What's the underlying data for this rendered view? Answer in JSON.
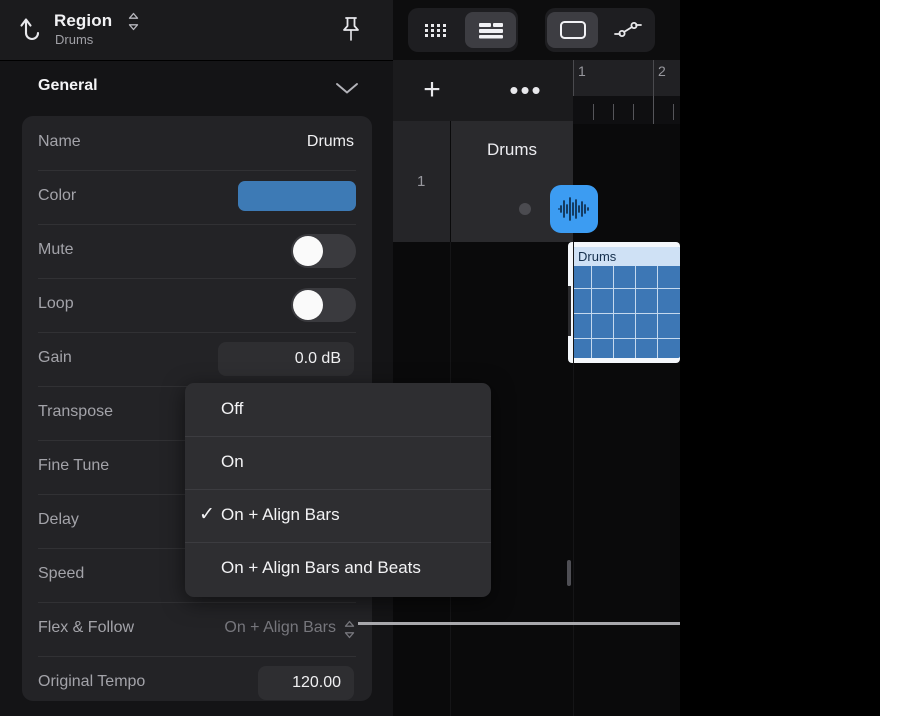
{
  "app": {
    "accent_blue": "#3c77b5",
    "track_icon_blue": "#3c9cf2",
    "color_swatch": "#3d7ab5"
  },
  "inspector": {
    "header": {
      "title": "Region",
      "subtitle": "Drums",
      "back_icon": "back-arrow-icon",
      "stepper_icon": "stepper-chevrons-icon",
      "pin_icon": "pin-icon"
    },
    "section": {
      "title": "General",
      "chevron_icon": "chevron-down-icon"
    },
    "parameters": [
      {
        "label": "Name",
        "value": "Drums",
        "kind": "text"
      },
      {
        "label": "Color",
        "value": "",
        "kind": "swatch"
      },
      {
        "label": "Mute",
        "value": "off",
        "kind": "toggle"
      },
      {
        "label": "Loop",
        "value": "off",
        "kind": "toggle"
      },
      {
        "label": "Gain",
        "value": "0.0 dB",
        "kind": "field"
      },
      {
        "label": "Transpose",
        "value": "",
        "kind": "hidden"
      },
      {
        "label": "Fine Tune",
        "value": "",
        "kind": "hidden"
      },
      {
        "label": "Delay",
        "value": "",
        "kind": "hidden"
      },
      {
        "label": "Speed",
        "value": "",
        "kind": "hidden"
      },
      {
        "label": "Flex & Follow",
        "value": "On + Align Bars",
        "kind": "stepper"
      },
      {
        "label": "Original Tempo",
        "value": "120.00",
        "kind": "field"
      }
    ]
  },
  "menu": {
    "items": [
      {
        "label": "Off",
        "checked": false
      },
      {
        "label": "On",
        "checked": false
      },
      {
        "label": "On + Align Bars",
        "checked": true
      },
      {
        "label": "On + Align Bars and Beats",
        "checked": false
      }
    ],
    "check_glyph": "✓"
  },
  "toolbar": {
    "groups": [
      {
        "buttons": [
          {
            "icon": "grid-dots-icon",
            "selected": false
          },
          {
            "icon": "list-view-icon",
            "selected": true
          }
        ]
      },
      {
        "buttons": [
          {
            "icon": "region-rectangle-icon",
            "selected": true
          },
          {
            "icon": "automation-curve-icon",
            "selected": false
          }
        ]
      }
    ]
  },
  "tracks_area": {
    "add_button_label": "+",
    "more_button_label": "•••",
    "ruler_bars": [
      "1",
      "2"
    ],
    "track": {
      "number": "1",
      "name": "Drums",
      "icon": "audio-waveform-icon"
    },
    "region": {
      "name": "Drums"
    }
  }
}
